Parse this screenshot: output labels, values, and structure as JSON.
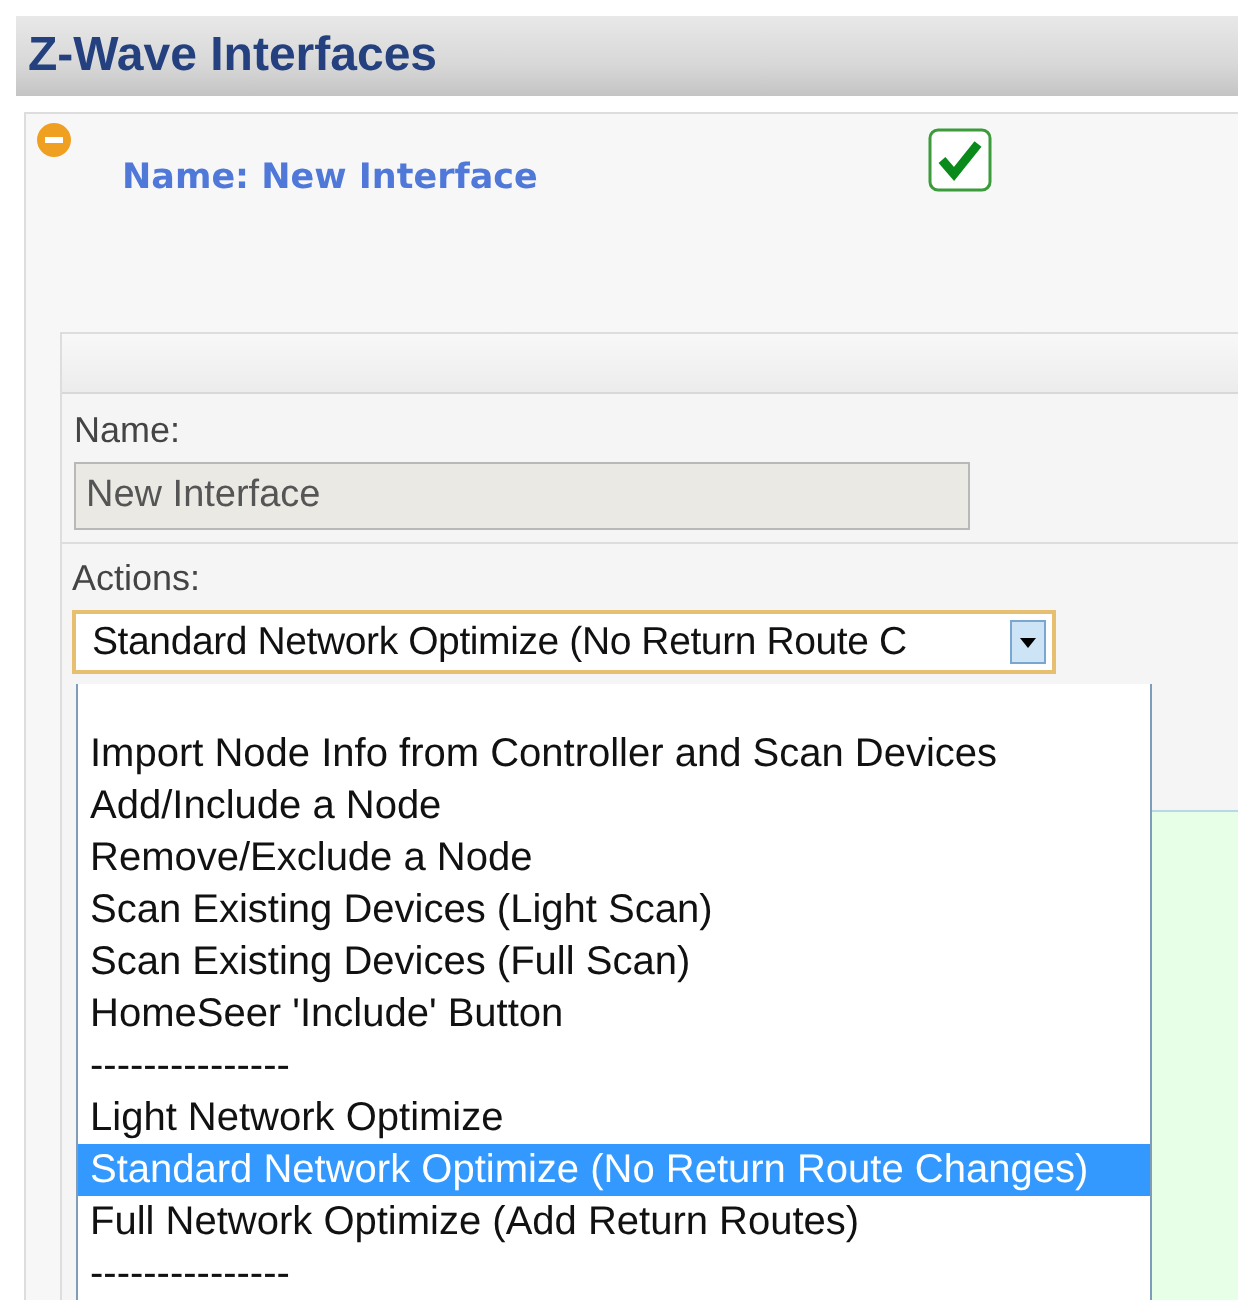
{
  "header": {
    "title": "Z-Wave Interfaces"
  },
  "panel": {
    "expanded": true,
    "name_heading": "Name: New Interface",
    "enabled": true
  },
  "form": {
    "name_label": "Name:",
    "name_value": "New Interface",
    "actions_label": "Actions:",
    "actions_value": "Standard Network Optimize (No Return Route C",
    "actions_options": [
      {
        "label": "Import Node Info from Controller and Scan Devices",
        "selected": false
      },
      {
        "label": "Add/Include a Node",
        "selected": false
      },
      {
        "label": "Remove/Exclude a Node",
        "selected": false
      },
      {
        "label": "Scan Existing Devices (Light Scan)",
        "selected": false
      },
      {
        "label": "Scan Existing Devices (Full Scan)",
        "selected": false
      },
      {
        "label": "HomeSeer 'Include' Button",
        "selected": false
      },
      {
        "label": "---------------",
        "selected": false
      },
      {
        "label": "Light Network Optimize",
        "selected": false
      },
      {
        "label": "Standard Network Optimize (No Return Route Changes)",
        "selected": true
      },
      {
        "label": "Full Network Optimize (Add Return Routes)",
        "selected": false
      },
      {
        "label": "---------------",
        "selected": false
      }
    ]
  }
}
